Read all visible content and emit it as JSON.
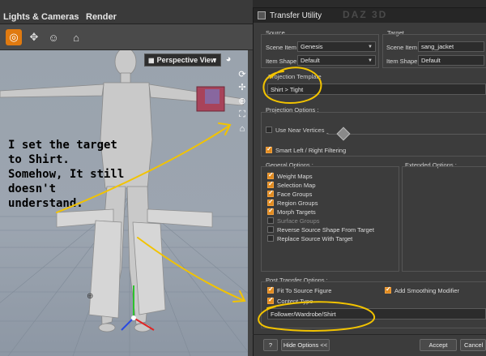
{
  "app": {
    "tabs": [
      "Lights & Cameras",
      "Render"
    ]
  },
  "viewport": {
    "view_label": "Perspective View",
    "annotation": "I set the target to Shirt. Somehow, It still doesn't understand."
  },
  "dialog": {
    "title": "Transfer Utility",
    "watermark": "DAZ 3D",
    "source": {
      "label": "Source",
      "scene_item_label": "Scene Item :",
      "scene_item_value": "Genesis",
      "item_shape_label": "Item Shape :",
      "item_shape_value": "Default"
    },
    "target": {
      "label": "Target",
      "scene_item_label": "Scene Item :",
      "scene_item_value": "sang_jacket",
      "item_shape_label": "Item Shape :",
      "item_shape_value": "Default"
    },
    "projection_template": {
      "label": "Projection Template",
      "value": "Shirt > Tight"
    },
    "projection_options": {
      "label": "Projection Options :",
      "use_near_vertices": {
        "label": "Use Near Vertices",
        "checked": false
      },
      "smart_filtering": {
        "label": "Smart Left / Right Filtering",
        "checked": true
      }
    },
    "general_options": {
      "label": "General Options :",
      "items": [
        {
          "label": "Weight Maps",
          "checked": true,
          "disabled": false
        },
        {
          "label": "Selection Map",
          "checked": true,
          "disabled": false
        },
        {
          "label": "Face Groups",
          "checked": true,
          "disabled": false
        },
        {
          "label": "Region Groups",
          "checked": true,
          "disabled": false
        },
        {
          "label": "Morph Targets",
          "checked": true,
          "disabled": false
        },
        {
          "label": "Surface Groups",
          "checked": false,
          "disabled": true
        },
        {
          "label": "Reverse Source Shape From Target",
          "checked": false,
          "disabled": false
        },
        {
          "label": "Replace Source With Target",
          "checked": false,
          "disabled": false
        }
      ]
    },
    "extended_options": {
      "label": "Extended Options :"
    },
    "post_transfer_options": {
      "label": "Post Transfer Options :",
      "fit_to_source": {
        "label": "Fit To Source Figure",
        "checked": true
      },
      "add_smoothing": {
        "label": "Add Smoothing Modifier",
        "checked": true
      },
      "content_type": {
        "label": "Content Type",
        "checked": true
      },
      "content_type_value": "Follower/Wardrobe/Shirt"
    },
    "buttons": {
      "help": "?",
      "hide_options": "Hide Options <<",
      "accept": "Accept",
      "cancel": "Cancel"
    }
  },
  "colors": {
    "accent": "#e07a10",
    "annotation_marker": "#f2c300"
  }
}
